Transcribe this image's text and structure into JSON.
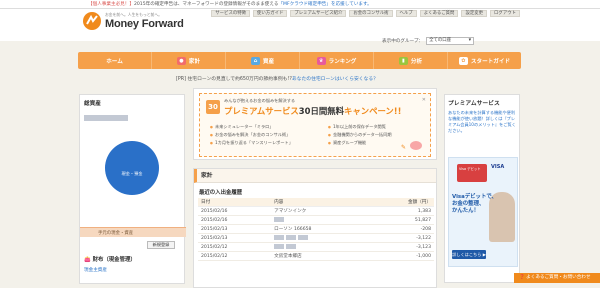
{
  "announce": {
    "tag": "【個人事業主必見！】",
    "text": "2015年の確定申告は、マネーフォワードの登録情報がそのまま使える",
    "link": "「MFクラウド確定申告」を応援しています。"
  },
  "logo": {
    "subtitle": "お金を前へ。人生をもっと前へ。",
    "title": "Money Forward"
  },
  "toplinks": [
    "サービスの特徴",
    "使い方ガイド",
    "プレミアムサービス紹介",
    "お金のコンサル術",
    "ヘルプ",
    "よくあるご質問",
    "設定変更",
    "ログアウト"
  ],
  "group": {
    "label": "表示中のグループ：",
    "selected": "全ての口座"
  },
  "nav": [
    {
      "label": "ホーム",
      "icon": "home-icon",
      "color": "#f5a04a"
    },
    {
      "label": "家計",
      "icon": "pig-icon",
      "color": "#f26c6c"
    },
    {
      "label": "資産",
      "icon": "house-icon",
      "color": "#5aa9e0"
    },
    {
      "label": "ランキング",
      "icon": "crown-icon",
      "color": "#e85a9c"
    },
    {
      "label": "分析",
      "icon": "chart-icon",
      "color": "#9bc53d"
    },
    {
      "label": "スタートガイド",
      "icon": "fan-icon",
      "color": "#f5a04a"
    }
  ],
  "pr": {
    "tag": "[PR]",
    "text": "住宅ローンの見直しで約650万円の節約事例も!?",
    "link": "あなたの住宅ローンはいくら安くなる？"
  },
  "assets": {
    "title": "総資産",
    "pie": {
      "label": "現金・預金",
      "percent": 100,
      "color": "#2a70c8"
    },
    "cash_tab": "手元の現金・資産",
    "new_button": "新規登録",
    "wallet_title": "財布（現金管理）",
    "cash_label": "現金主資産"
  },
  "banner": {
    "icon_text": "30",
    "sub": "みんなが抱えるお金の悩みを解決する",
    "title_a": "プレミアムサービス",
    "title_b": "30日間無料",
    "title_c": "キャンペーン!!",
    "items": [
      "未来シミュレーター「ミラロ」",
      "1年以上前の保存データ閲覧",
      "お金の悩みを解決「お金のコンサル術」",
      "金融機関からのデータ一括同期",
      "1カ月を振り返る「マンスリーレポート」",
      "資産グループ機能"
    ]
  },
  "kakei": {
    "title": "家計",
    "recent_title": "最近の入出金履歴",
    "columns": [
      "日付",
      "内容",
      "金額（円）"
    ],
    "rows": [
      {
        "date": "2015/02/16",
        "content": "アマゾンインク",
        "amount": "1,383"
      },
      {
        "date": "2015/02/16",
        "content": "",
        "amount": "51,827"
      },
      {
        "date": "2015/02/13",
        "content": "ローソン 166658",
        "amount": "-208"
      },
      {
        "date": "2015/02/13",
        "content": "",
        "amount": "-3,122"
      },
      {
        "date": "2015/02/12",
        "content": "",
        "amount": "-3,123"
      },
      {
        "date": "2015/02/12",
        "content": "文房堂本郷店",
        "amount": "-1,000"
      }
    ]
  },
  "premium": {
    "title": "プレミアムサービス",
    "text": "あなたの未来を計算する機能や便利な機能が使い放題！詳しくは『プレミアム会員10のメリット』をご覧ください。",
    "card_text": "Visa デビット",
    "visa": "VISA",
    "ad_line1": "Visaデビットで、",
    "ad_line2": "お金の整理、",
    "ad_line3": "かんたん！",
    "ad_button": "詳しくはこちら ▶"
  },
  "help": "❓ よくあるご質問・お問い合わせ"
}
